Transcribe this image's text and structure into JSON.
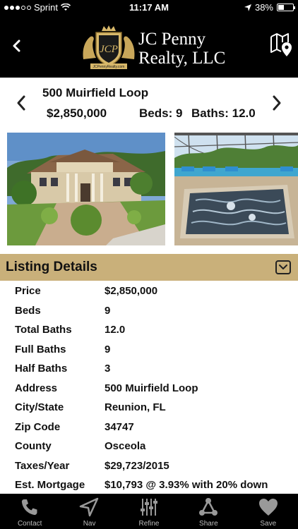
{
  "status_bar": {
    "carrier": "Sprint",
    "time": "11:17 AM",
    "battery_percent": "38%",
    "battery_level": 0.38,
    "signal_dots_filled": 3,
    "signal_dots_total": 5
  },
  "header": {
    "brand_line1": "JC Penny",
    "brand_line2": "Realty, LLC",
    "logo_initials": "JCP",
    "logo_banner": "JCPennyRealty.com",
    "back_icon": "chevron-left-icon",
    "map_icon": "map-pin-icon"
  },
  "property": {
    "address": "500 Muirfield Loop",
    "price": "$2,850,000",
    "beds": "Beds: 9",
    "baths": "Baths: 12.0"
  },
  "photos": [
    {
      "subject": "mansion exterior"
    },
    {
      "subject": "pool and spa"
    }
  ],
  "listing": {
    "section_title": "Listing Details",
    "rows": [
      {
        "label": "Price",
        "value": "$2,850,000"
      },
      {
        "label": "Beds",
        "value": "9"
      },
      {
        "label": "Total Baths",
        "value": "12.0"
      },
      {
        "label": "Full Baths",
        "value": "9"
      },
      {
        "label": "Half Baths",
        "value": "3"
      },
      {
        "label": "Address",
        "value": "500 Muirfield Loop"
      },
      {
        "label": "City/State",
        "value": "Reunion, FL"
      },
      {
        "label": "Zip Code",
        "value": "34747"
      },
      {
        "label": "County",
        "value": "Osceola"
      },
      {
        "label": "Taxes/Year",
        "value": "$29,723/2015"
      },
      {
        "label": "Est. Mortgage",
        "value": "$10,793 @ 3.93% with 20% down"
      }
    ]
  },
  "tabs": [
    {
      "label": "Contact",
      "icon": "phone-icon"
    },
    {
      "label": "Nav",
      "icon": "navigation-arrow-icon"
    },
    {
      "label": "Refine",
      "icon": "sliders-icon"
    },
    {
      "label": "Share",
      "icon": "share-icon"
    },
    {
      "label": "Save",
      "icon": "heart-icon"
    }
  ],
  "colors": {
    "accent_gold": "#c9b07a",
    "header_bg": "#000000",
    "tab_label": "#bbbbbb"
  }
}
